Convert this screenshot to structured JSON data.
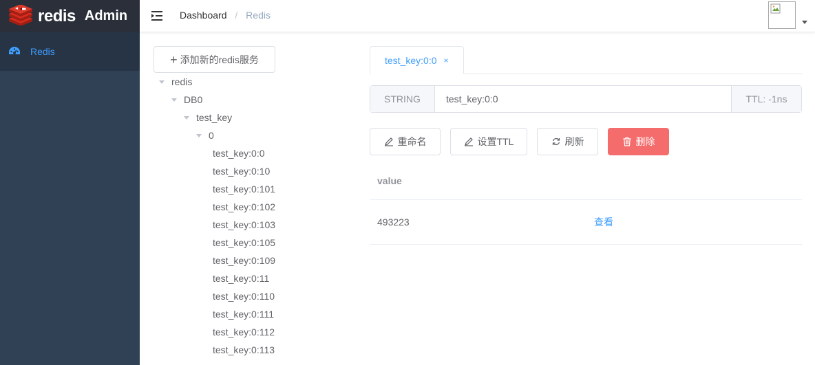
{
  "app": {
    "logo_text": "redis",
    "title": "Admin"
  },
  "sidebar": {
    "items": [
      {
        "label": "Redis",
        "icon": "dashboard-icon",
        "active": true
      }
    ]
  },
  "breadcrumb": {
    "home": "Dashboard",
    "separator": "/",
    "current": "Redis"
  },
  "tree": {
    "add_button": "添加新的redis服务",
    "nodes": [
      {
        "label": "redis",
        "level": 0,
        "expanded": true
      },
      {
        "label": "DB0",
        "level": 1,
        "expanded": true
      },
      {
        "label": "test_key",
        "level": 2,
        "expanded": true
      },
      {
        "label": "0",
        "level": 3,
        "expanded": true
      },
      {
        "label": "test_key:0:0",
        "level": 4
      },
      {
        "label": "test_key:0:10",
        "level": 4
      },
      {
        "label": "test_key:0:101",
        "level": 4
      },
      {
        "label": "test_key:0:102",
        "level": 4
      },
      {
        "label": "test_key:0:103",
        "level": 4
      },
      {
        "label": "test_key:0:105",
        "level": 4
      },
      {
        "label": "test_key:0:109",
        "level": 4
      },
      {
        "label": "test_key:0:11",
        "level": 4
      },
      {
        "label": "test_key:0:110",
        "level": 4
      },
      {
        "label": "test_key:0:111",
        "level": 4
      },
      {
        "label": "test_key:0:112",
        "level": 4
      },
      {
        "label": "test_key:0:113",
        "level": 4
      }
    ]
  },
  "detail": {
    "tab": {
      "label": "test_key:0:0",
      "close": "×"
    },
    "key_type": "STRING",
    "key_name": "test_key:0:0",
    "ttl": "TTL: -1ns",
    "buttons": {
      "rename": "重命名",
      "set_ttl": "设置TTL",
      "refresh": "刷新",
      "delete": "删除"
    },
    "table": {
      "header": "value",
      "rows": [
        {
          "value": "493223",
          "action": "查看"
        }
      ]
    }
  },
  "colors": {
    "sidebar_bg": "#304156",
    "logo_bg": "#2b2f3a",
    "accent": "#409eff",
    "danger": "#f56c6c",
    "redis_red": "#d82c20"
  }
}
